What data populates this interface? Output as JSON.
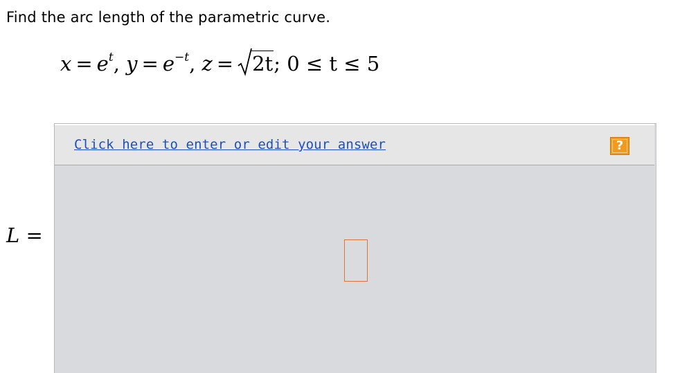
{
  "prompt": "Find the arc length of the parametric curve.",
  "equation": {
    "x_var": "x",
    "eq1": "=",
    "x_base": "e",
    "x_exp": "t",
    "sep1": ",",
    "y_var": "y",
    "eq2": "=",
    "y_base": "e",
    "y_exp": "−t",
    "sep2": ",",
    "z_var": "z",
    "eq3": "=",
    "z_radicand": "2t",
    "range": "; 0 ≤ t ≤ 5"
  },
  "answer_label": {
    "var": "L",
    "eq": "="
  },
  "answer_box": {
    "edit_link": "Click here to enter or edit your answer",
    "help_icon_text": "?",
    "help_icon": "question-icon",
    "accent_color": "#f39a1c",
    "link_color": "#1c4fbf",
    "input_value": ""
  }
}
